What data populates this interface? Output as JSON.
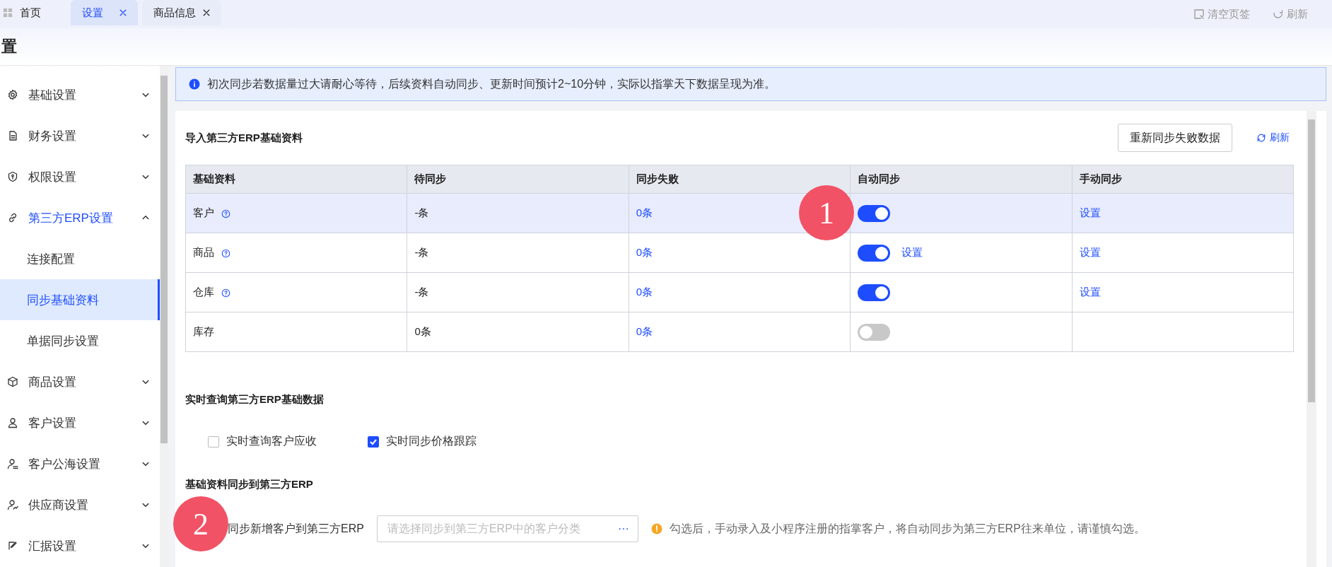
{
  "tabs": [
    {
      "label": "首页",
      "kind": "home",
      "selected": false
    },
    {
      "label": "设置",
      "kind": "closable",
      "selected": true
    },
    {
      "label": "商品信息",
      "kind": "closable",
      "selected": false
    }
  ],
  "header_actions": [
    {
      "label": "清空页签",
      "kind": "clear"
    },
    {
      "label": "刷新",
      "kind": "refresh"
    }
  ],
  "page_title": "置",
  "sidebar": {
    "items": [
      {
        "label": "基础设置",
        "expanded": false
      },
      {
        "label": "财务设置",
        "expanded": false
      },
      {
        "label": "权限设置",
        "expanded": false
      },
      {
        "label": "第三方ERP设置",
        "expanded": true,
        "children": [
          {
            "label": "连接配置",
            "selected": false
          },
          {
            "label": "同步基础资料",
            "selected": true
          },
          {
            "label": "单据同步设置",
            "selected": false
          }
        ]
      },
      {
        "label": "商品设置",
        "expanded": false
      },
      {
        "label": "客户设置",
        "expanded": false
      },
      {
        "label": "客户公海设置",
        "expanded": false
      },
      {
        "label": "供应商设置",
        "expanded": false
      },
      {
        "label": "汇据设置",
        "expanded": false
      }
    ]
  },
  "notice": "初次同步若数据量过大请耐心等待，后续资料自动同步、更新时间预计2~10分钟，实际以指掌天下数据呈现为准。",
  "import_section": {
    "title": "导入第三方ERP基础资料",
    "retry_button": "重新同步失败数据",
    "refresh_link": "刷新",
    "table": {
      "columns": [
        "基础资料",
        "待同步",
        "同步失败",
        "自动同步",
        "手动同步"
      ],
      "rows": [
        {
          "name": "客户",
          "help": true,
          "pending": "-条",
          "failed": "0条",
          "auto_sync": true,
          "manual_link": "设置",
          "selected": true
        },
        {
          "name": "商品",
          "help": true,
          "pending": "-条",
          "failed": "0条",
          "auto_sync": true,
          "auto_link": "设置",
          "manual_link": "设置",
          "selected": false
        },
        {
          "name": "仓库",
          "help": true,
          "pending": "-条",
          "failed": "0条",
          "auto_sync": true,
          "manual_link": "设置",
          "selected": false
        },
        {
          "name": "库存",
          "help": false,
          "pending": "0条",
          "failed": "0条",
          "auto_sync": false,
          "selected": false
        }
      ]
    }
  },
  "realtime_section": {
    "title": "实时查询第三方ERP基础数据",
    "options": [
      {
        "label": "实时查询客户应收",
        "checked": false
      },
      {
        "label": "实时同步价格跟踪",
        "checked": true
      }
    ]
  },
  "push_section": {
    "title": "基础资料同步到第三方ERP",
    "field_label": "同步新增客户到第三方ERP",
    "field_placeholder": "请选择同步到第三方ERP中的客户分类",
    "field_button": "···",
    "warning": "勾选后，手动录入及小程序注册的指掌客户，将自动同步为第三方ERP往来单位，请谨慎勾选。"
  },
  "annotations": [
    {
      "label": "1"
    },
    {
      "label": "2"
    }
  ]
}
